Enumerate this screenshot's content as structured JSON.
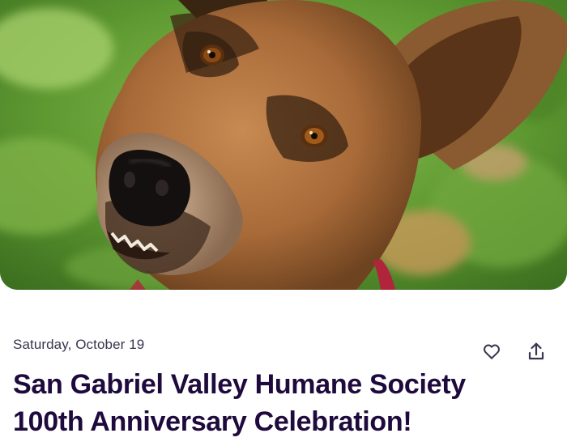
{
  "hero": {
    "image_subject": "German Shepherd dog close-up on grass"
  },
  "event": {
    "date": "Saturday, October 19",
    "title_line1": "San Gabriel Valley Humane Society",
    "title_line2": "100th Anniversary Celebration!"
  },
  "actions": {
    "like_icon": "heart-outline-icon",
    "share_icon": "share-upload-icon"
  },
  "colors": {
    "title": "#1e0a3c",
    "date": "#39364f",
    "icon": "#39364f"
  }
}
